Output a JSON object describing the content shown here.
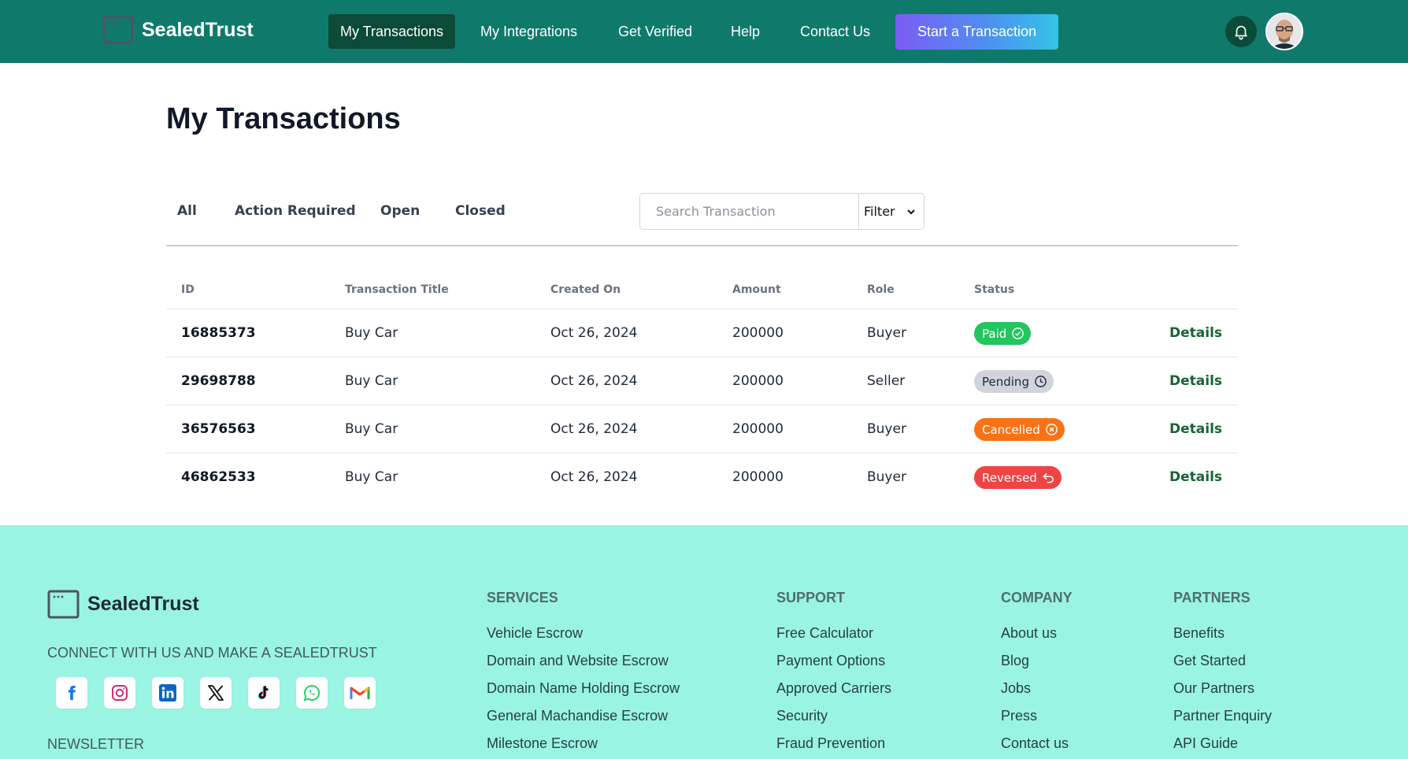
{
  "header": {
    "brand": "SealedTrust",
    "nav": [
      "My Transactions",
      "My Integrations",
      "Get Verified",
      "Help",
      "Contact Us"
    ],
    "cta": "Start a Transaction"
  },
  "main": {
    "title": "My Transactions",
    "tabs": [
      "All",
      "Action Required",
      "Open",
      "Closed"
    ],
    "search_placeholder": "Search Transaction",
    "filter_label": "Filter",
    "columns": [
      "ID",
      "Transaction Title",
      "Created On",
      "Amount",
      "Role",
      "Status"
    ],
    "rows": [
      {
        "id": "16885373",
        "title": "Buy Car",
        "created": "Oct 26, 2024",
        "amount": "200000",
        "role": "Buyer",
        "status": "Paid",
        "action": "Details"
      },
      {
        "id": "29698788",
        "title": "Buy Car",
        "created": "Oct 26, 2024",
        "amount": "200000",
        "role": "Seller",
        "status": "Pending",
        "action": "Details"
      },
      {
        "id": "36576563",
        "title": "Buy Car",
        "created": "Oct 26, 2024",
        "amount": "200000",
        "role": "Buyer",
        "status": "Cancelled",
        "action": "Details"
      },
      {
        "id": "46862533",
        "title": "Buy Car",
        "created": "Oct 26, 2024",
        "amount": "200000",
        "role": "Buyer",
        "status": "Reversed",
        "action": "Details"
      }
    ],
    "status_colors": {
      "Paid": "#22c55e",
      "Pending": "#d1d5db",
      "Cancelled": "#f97316",
      "Reversed": "#ef4444"
    }
  },
  "footer": {
    "brand": "SealedTrust",
    "connect": "CONNECT WITH US AND MAKE A SEALEDTRUST",
    "newsletter": "NEWSLETTER",
    "socials": [
      "facebook-icon",
      "instagram-icon",
      "linkedin-icon",
      "x-icon",
      "tiktok-icon",
      "whatsapp-icon",
      "gmail-icon"
    ],
    "columns": [
      {
        "heading": "SERVICES",
        "links": [
          "Vehicle Escrow",
          "Domain and Website Escrow",
          "Domain Name Holding Escrow",
          "General Machandise Escrow",
          "Milestone Escrow"
        ]
      },
      {
        "heading": "SUPPORT",
        "links": [
          "Free Calculator",
          "Payment Options",
          "Approved Carriers",
          "Security",
          "Fraud Prevention"
        ]
      },
      {
        "heading": "COMPANY",
        "links": [
          "About us",
          "Blog",
          "Jobs",
          "Press",
          "Contact us"
        ]
      },
      {
        "heading": "PARTNERS",
        "links": [
          "Benefits",
          "Get Started",
          "Our Partners",
          "Partner Enquiry",
          "API Guide"
        ]
      }
    ]
  },
  "colors": {
    "header_bg": "#0f7a6c",
    "active_nav_bg": "#0b4b37",
    "footer_bg": "#9af4e2",
    "details_link": "#166534"
  }
}
